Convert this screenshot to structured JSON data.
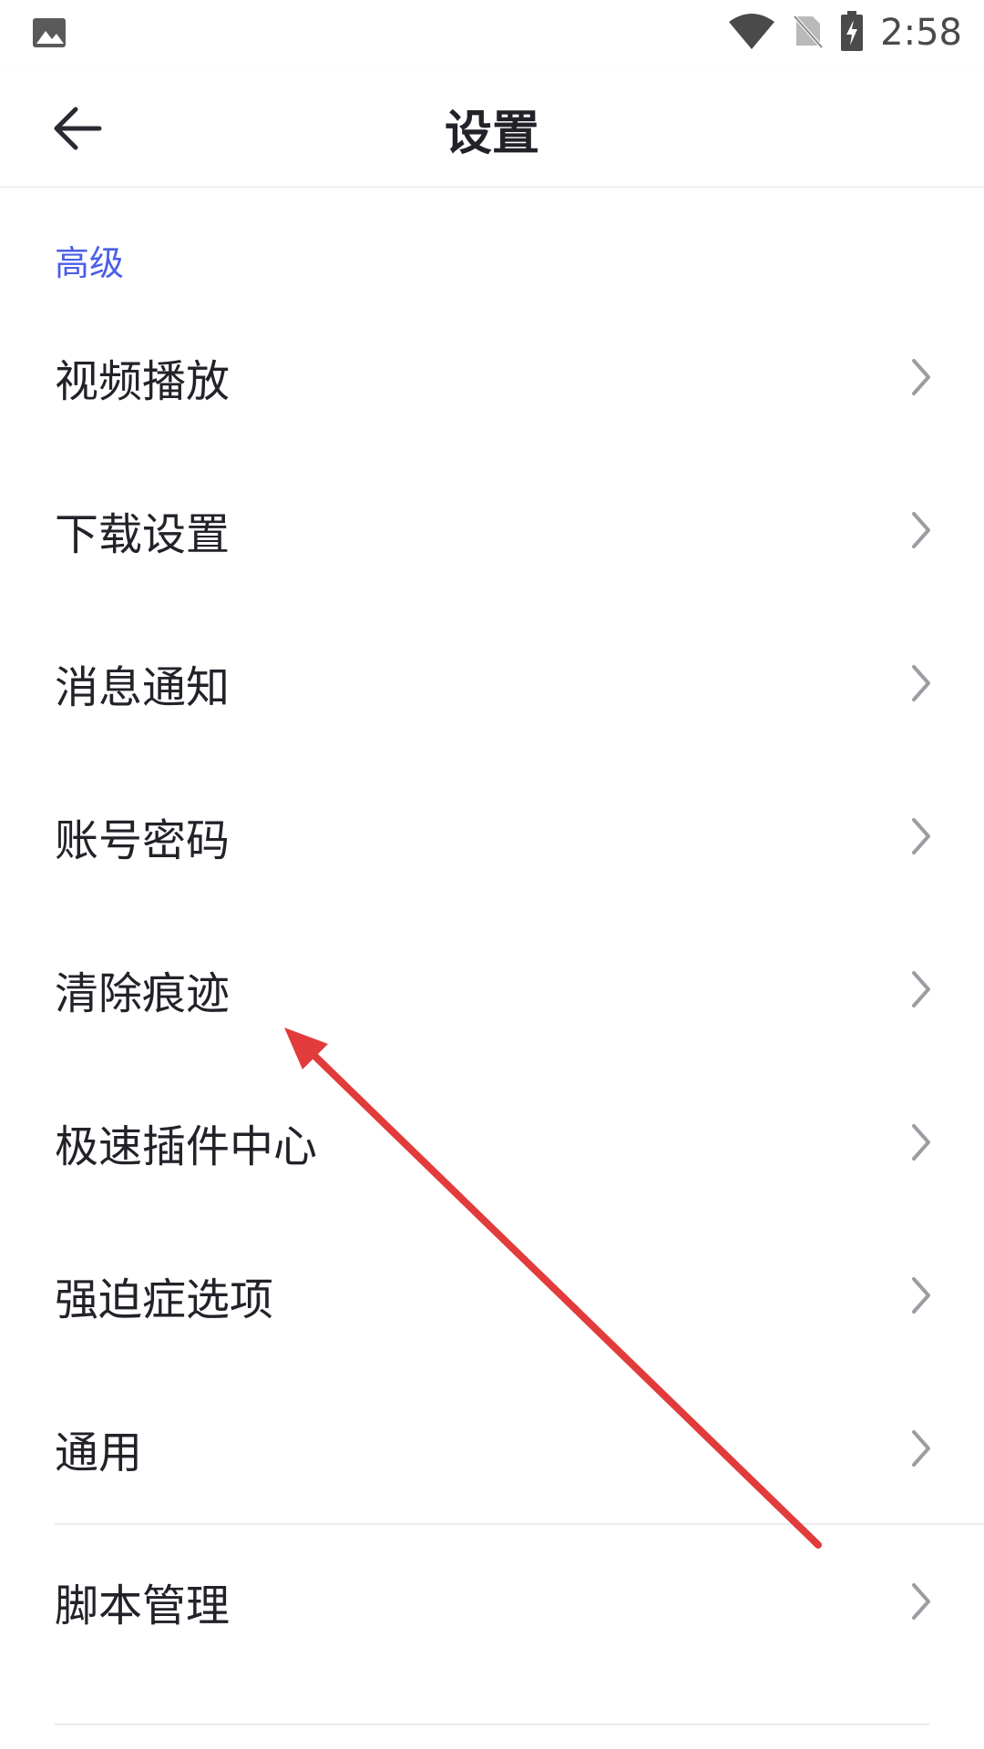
{
  "status_bar": {
    "time": "2:58",
    "icons": [
      "gallery-icon",
      "wifi-icon",
      "no-sim-icon",
      "battery-charging-icon"
    ]
  },
  "app_bar": {
    "title": "设置",
    "back_icon": "arrow-left-icon"
  },
  "section": {
    "header": "高级",
    "header_color": "#4b5fe6"
  },
  "items": [
    {
      "label": "视频播放"
    },
    {
      "label": "下载设置"
    },
    {
      "label": "消息通知"
    },
    {
      "label": "账号密码"
    },
    {
      "label": "清除痕迹"
    },
    {
      "label": "极速插件中心"
    },
    {
      "label": "强迫症选项"
    },
    {
      "label": "通用"
    },
    {
      "label": "脚本管理"
    }
  ],
  "annotation": {
    "type": "arrow",
    "color": "#e23b3b",
    "points_to": "清除痕迹"
  }
}
